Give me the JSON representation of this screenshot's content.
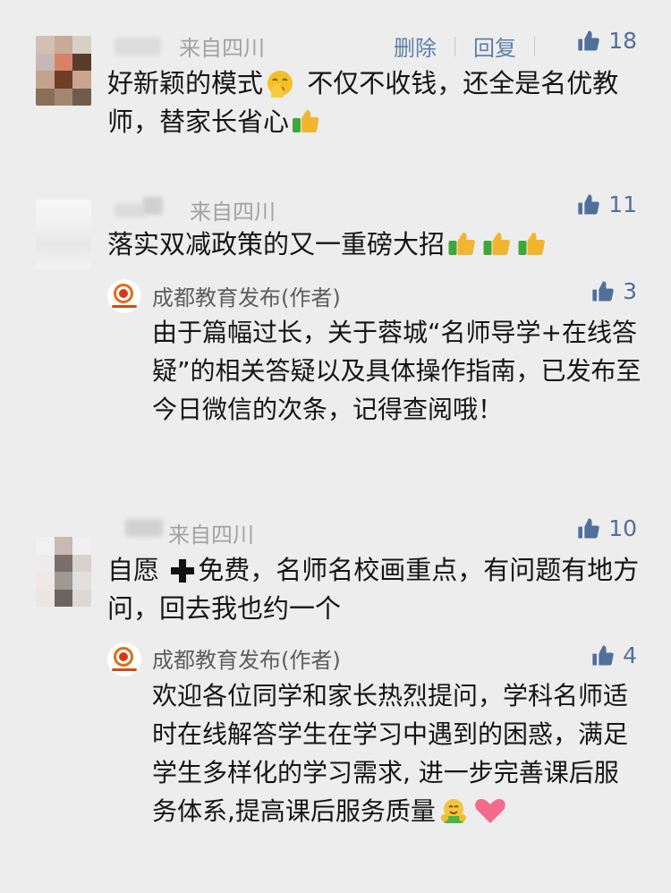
{
  "comments": [
    {
      "location": "来自四川",
      "delete_label": "删除",
      "reply_label": "回复",
      "likes": "18",
      "text_before_emoji": "好新颖的模式",
      "text_after_emoji": " 不仅不收钱，还全是名优教师，替家长省心",
      "emoji_1": "shushing-face-icon",
      "emoji_2": "thumbs-up-icon"
    },
    {
      "location": "来自四川",
      "likes": "11",
      "text": "落实双减政策的又一重磅大招",
      "emoji": "thumbs-up-icon",
      "reply": {
        "author": "成都教育发布(作者)",
        "likes": "3",
        "text": "由于篇幅过长，关于蓉城“名师导学+在线答疑”的相关答疑以及具体操作指南，已发布至今日微信的次条，记得查阅哦！"
      }
    },
    {
      "location": "来自四川",
      "likes": "10",
      "text_before_emoji": "自愿 ",
      "text_after_emoji": "免费，名师名校画重点，有问题有地方问，回去我也约一个",
      "emoji": "heavy-plus-icon",
      "reply": {
        "author": "成都教育发布(作者)",
        "likes": "4",
        "text": "欢迎各位同学和家长热烈提问，学科名师适时在线解答学生在学习中遇到的困惑，满足学生多样化的学习需求, 进一步完善课后服务体系,提高课后服务质量",
        "emoji_1": "hug-face-icon",
        "emoji_2": "heart-icon"
      }
    }
  ],
  "colors": {
    "background": "#ededed",
    "meta": "#a2a2a2",
    "action_link": "#5f7fa8",
    "like_icon": "#50709b"
  }
}
